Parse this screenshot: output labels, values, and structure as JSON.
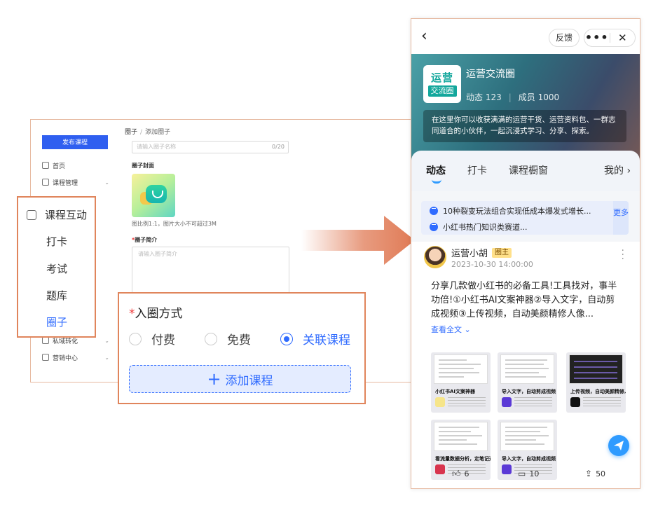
{
  "admin": {
    "publish_button": "发布课程",
    "sidebar_items": [
      "首页",
      "课程管理",
      "私域转化",
      "营销中心"
    ],
    "breadcrumb": {
      "root": "圈子",
      "sep": "/",
      "current": "添加圈子"
    },
    "name_placeholder": "请输入圈子名称",
    "name_count": "0/20",
    "cover_label": "圈子封面",
    "cover_hint": "图比例1:1，图片大小不可超过3M",
    "intro_label": "圈子简介",
    "intro_star": "*",
    "intro_placeholder": "请输入圈子简介"
  },
  "zoom_sidebar": {
    "header": "课程互动",
    "items": [
      "打卡",
      "考试",
      "题库",
      "圈子"
    ],
    "active_index": 3
  },
  "zoom_join": {
    "star": "*",
    "title": "入圈方式",
    "options": [
      "付费",
      "免费",
      "关联课程"
    ],
    "selected_index": 2,
    "add_button": "添加课程",
    "add_plus": "+"
  },
  "phone": {
    "feedback": "反馈",
    "more": "•••",
    "close": "✕",
    "back": "‹",
    "circle_name": "运营交流圈",
    "logo_line1": "运营",
    "logo_line2": "交流圈",
    "stats_posts": "动态 123",
    "stats_sep": "|",
    "stats_members": "成员 1000",
    "description": "在这里你可以收获满满的运营干货、运营资料包、一群志同道合的小伙伴，一起沉浸式学习、分享、探索。",
    "tabs": [
      "动态",
      "打卡",
      "课程橱窗",
      "我的 ›"
    ],
    "active_tab": 0,
    "notices": [
      "10种裂变玩法组合实现低成本爆发式增长...",
      "小红书热门知识类赛道..."
    ],
    "notice_more": "更多",
    "author": "运营小胡",
    "author_badge": "圈主",
    "post_time": "2023-10-30 14:00:00",
    "post_text": "分享几款做小红书的必备工具!工具找对，事半功倍!①小红书AI文案神器②导入文字，自动剪成视频③上传视频，自动美颜精修人像...",
    "expand": "查看全文",
    "thumb_captions": [
      "小红书AI文案神器",
      "导入文字，自动剪成视频",
      "上传视频，自动美颜精修人像",
      "看流量数据分析，定笔记选题",
      "导入文字，自动剪成视频"
    ],
    "likes": "6",
    "comments": "10",
    "shares": "50"
  },
  "colors": {
    "accent": "#2f6bff",
    "highlight_border": "#e0855c",
    "arrow": "#e07a55"
  }
}
